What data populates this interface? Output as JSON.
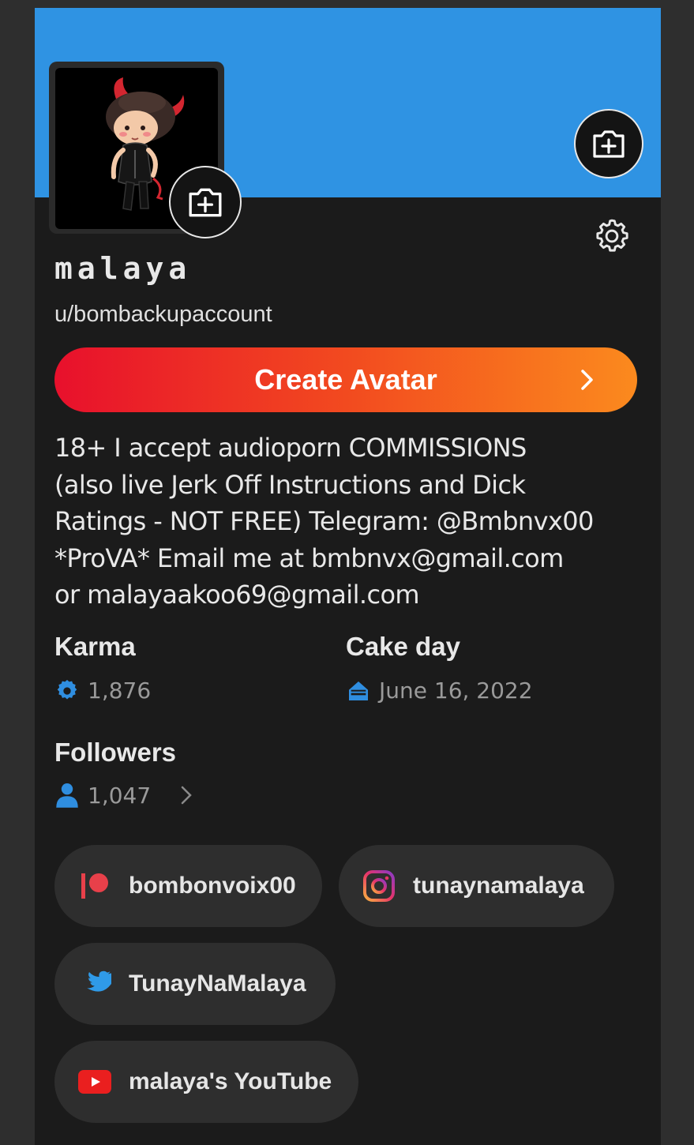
{
  "profile": {
    "display_name": "malaya",
    "username": "u/bombackupaccount",
    "create_avatar_label": "Create Avatar",
    "bio": "18+ I accept audioporn COMMISSIONS\n(also live Jerk Off Instructions and Dick\nRatings - NOT FREE) Telegram: @Bmbnvx00\n*ProVA* Email me at bmbnvx@gmail.com\nor malayaakoo69@gmail.com"
  },
  "stats": {
    "karma_label": "Karma",
    "karma_value": "1,876",
    "cakeday_label": "Cake day",
    "cakeday_value": "June 16, 2022",
    "followers_label": "Followers",
    "followers_value": "1,047"
  },
  "social_links": [
    {
      "label": "bombonvoix00",
      "icon": "patreon-icon"
    },
    {
      "label": "tunaynamalaya",
      "icon": "instagram-icon"
    },
    {
      "label": "TunayNaMalaya",
      "icon": "twitter-icon"
    },
    {
      "label": "malaya's YouTube",
      "icon": "youtube-icon"
    }
  ],
  "colors": {
    "banner": "#2f93e3",
    "background": "#1b1b1b",
    "accent_blue": "#2f8ee0",
    "gradient_start": "#e8102c",
    "gradient_end": "#fb8a1e"
  }
}
